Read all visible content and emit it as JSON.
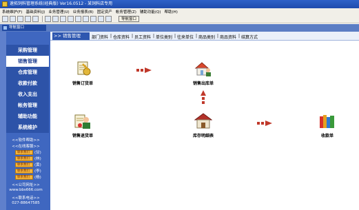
{
  "window": {
    "title": "速拓饲料管理系统(经典版) Ver16.0512 - 某饲料店专用"
  },
  "menu": [
    "系统维护(F)",
    "基础资料(J)",
    "业务管理(U)",
    "业务报表(B)",
    "固定资产",
    "帐务管理(Z)",
    "辅助功能(Q)",
    "帮助(H)"
  ],
  "toolbar": {
    "nav_window_label": "导航窗口"
  },
  "panel": {
    "title": "导航窗口"
  },
  "sidebar": {
    "items": [
      {
        "label": "采购管理",
        "active": false
      },
      {
        "label": "销售管理",
        "active": true
      },
      {
        "label": "仓库管理",
        "active": false
      },
      {
        "label": "收款付款",
        "active": false
      },
      {
        "label": "收入支出",
        "active": false
      },
      {
        "label": "帐务管理",
        "active": false
      },
      {
        "label": "辅助功能",
        "active": false
      },
      {
        "label": "系统维护",
        "active": false
      }
    ],
    "help_link": "<<软件帮助>>",
    "qq_header": "<<在线客服>>",
    "qq_badge": "联系我们",
    "qq_contacts": [
      "(甘)",
      "(林)",
      "(黄)",
      "(李)",
      "(杨)"
    ],
    "website_header": "<<公司网址>>",
    "website": "www.bbs666.com",
    "phone_header": "<<联系电话>>",
    "phone": "027-88647585"
  },
  "main": {
    "section_title": ">> 销售管理",
    "tabs": [
      "部门资料",
      "仓库资料",
      "员工资料",
      "单位类别",
      "往来单位",
      "商品类别",
      "商品资料",
      "结算方式"
    ],
    "modules": {
      "sales_order": "销售订货单",
      "sales_out": "销售出库单",
      "sales_return": "销售退货单",
      "stock_detail": "库存明细表",
      "receipt": "收款单"
    }
  },
  "colors": {
    "sidebar_bg": "#3f67c0",
    "sidebar_item_bg": "#2d53a8",
    "active_item_bg": "#ffffff",
    "section_title_bg": "#2e57b0",
    "arrow_color": "#c0392b"
  }
}
